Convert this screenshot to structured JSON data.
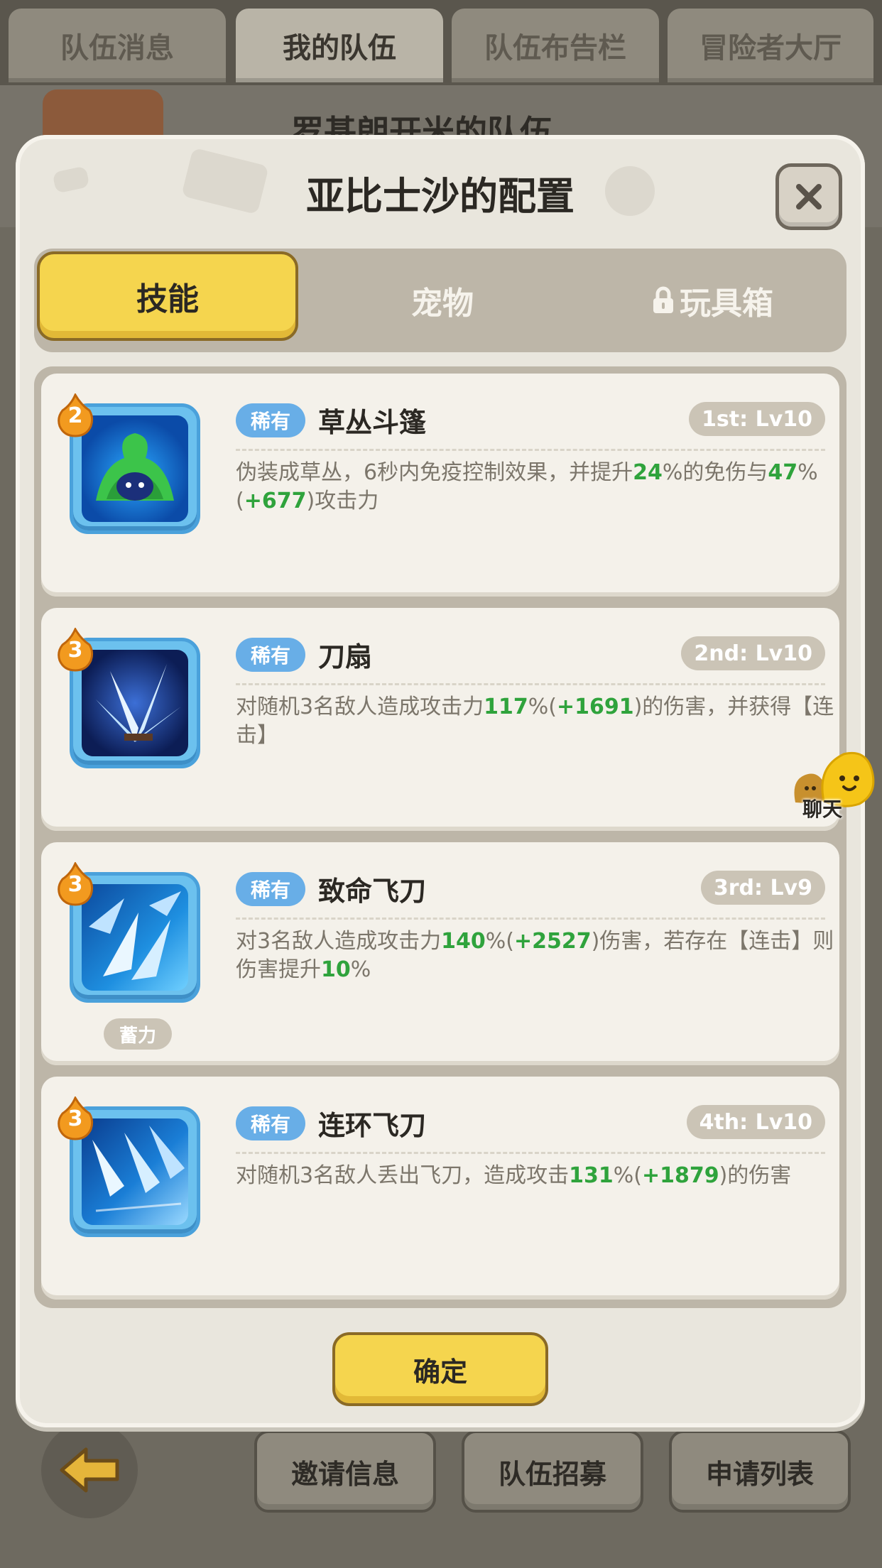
{
  "background": {
    "top_tabs": [
      "队伍消息",
      "我的队伍",
      "队伍布告栏",
      "冒险者大厅"
    ],
    "active_top_tab": "我的队伍",
    "header_title": "罗基朗开米的队伍",
    "bottom_buttons": [
      "邀请信息",
      "队伍招募",
      "申请列表"
    ]
  },
  "modal": {
    "title": "亚比士沙的配置",
    "tabs": [
      {
        "label": "技能",
        "active": true,
        "locked": false
      },
      {
        "label": "宠物",
        "active": false,
        "locked": false
      },
      {
        "label": "玩具箱",
        "active": false,
        "locked": true
      }
    ],
    "skills": [
      {
        "level": "2",
        "rarity": "稀有",
        "name": "草丛斗篷",
        "slot": "1st: Lv10",
        "desc": [
          {
            "t": "伪装成草丛，6秒内免疫控制效果，并提升"
          },
          {
            "t": "24",
            "g": true
          },
          {
            "t": "%的免伤与"
          },
          {
            "t": "47",
            "g": true
          },
          {
            "t": "%("
          },
          {
            "t": "+677",
            "g": true
          },
          {
            "t": ")攻击力"
          }
        ]
      },
      {
        "level": "3",
        "rarity": "稀有",
        "name": "刀扇",
        "slot": "2nd: Lv10",
        "desc": [
          {
            "t": "对随机3名敌人造成攻击力"
          },
          {
            "t": "117",
            "g": true
          },
          {
            "t": "%("
          },
          {
            "t": "+1691",
            "g": true
          },
          {
            "t": ")的伤害，并获得【连击】"
          }
        ]
      },
      {
        "level": "3",
        "rarity": "稀有",
        "name": "致命飞刀",
        "slot": "3rd: Lv9",
        "tag": "蓄力",
        "desc": [
          {
            "t": "对3名敌人造成攻击力"
          },
          {
            "t": "140",
            "g": true
          },
          {
            "t": "%("
          },
          {
            "t": "+2527",
            "g": true
          },
          {
            "t": ")伤害，若存在【连击】则伤害提升"
          },
          {
            "t": "10",
            "g": true
          },
          {
            "t": "%"
          }
        ]
      },
      {
        "level": "3",
        "rarity": "稀有",
        "name": "连环飞刀",
        "slot": "4th: Lv10",
        "desc": [
          {
            "t": "对随机3名敌人丢出飞刀，造成攻击"
          },
          {
            "t": "131",
            "g": true
          },
          {
            "t": "%("
          },
          {
            "t": "+1879",
            "g": true
          },
          {
            "t": ")的伤害"
          }
        ]
      }
    ],
    "confirm_label": "确定"
  },
  "chat": {
    "label": "聊天"
  },
  "colors": {
    "accent_yellow": "#f5d54e",
    "rarity_blue": "#68aee7",
    "value_green": "#2fa33c",
    "panel": "#e9e6dd"
  },
  "icons": [
    "close-icon",
    "lock-icon",
    "back-arrow-icon",
    "chat-mascot-icon",
    "level-flame-badge"
  ]
}
